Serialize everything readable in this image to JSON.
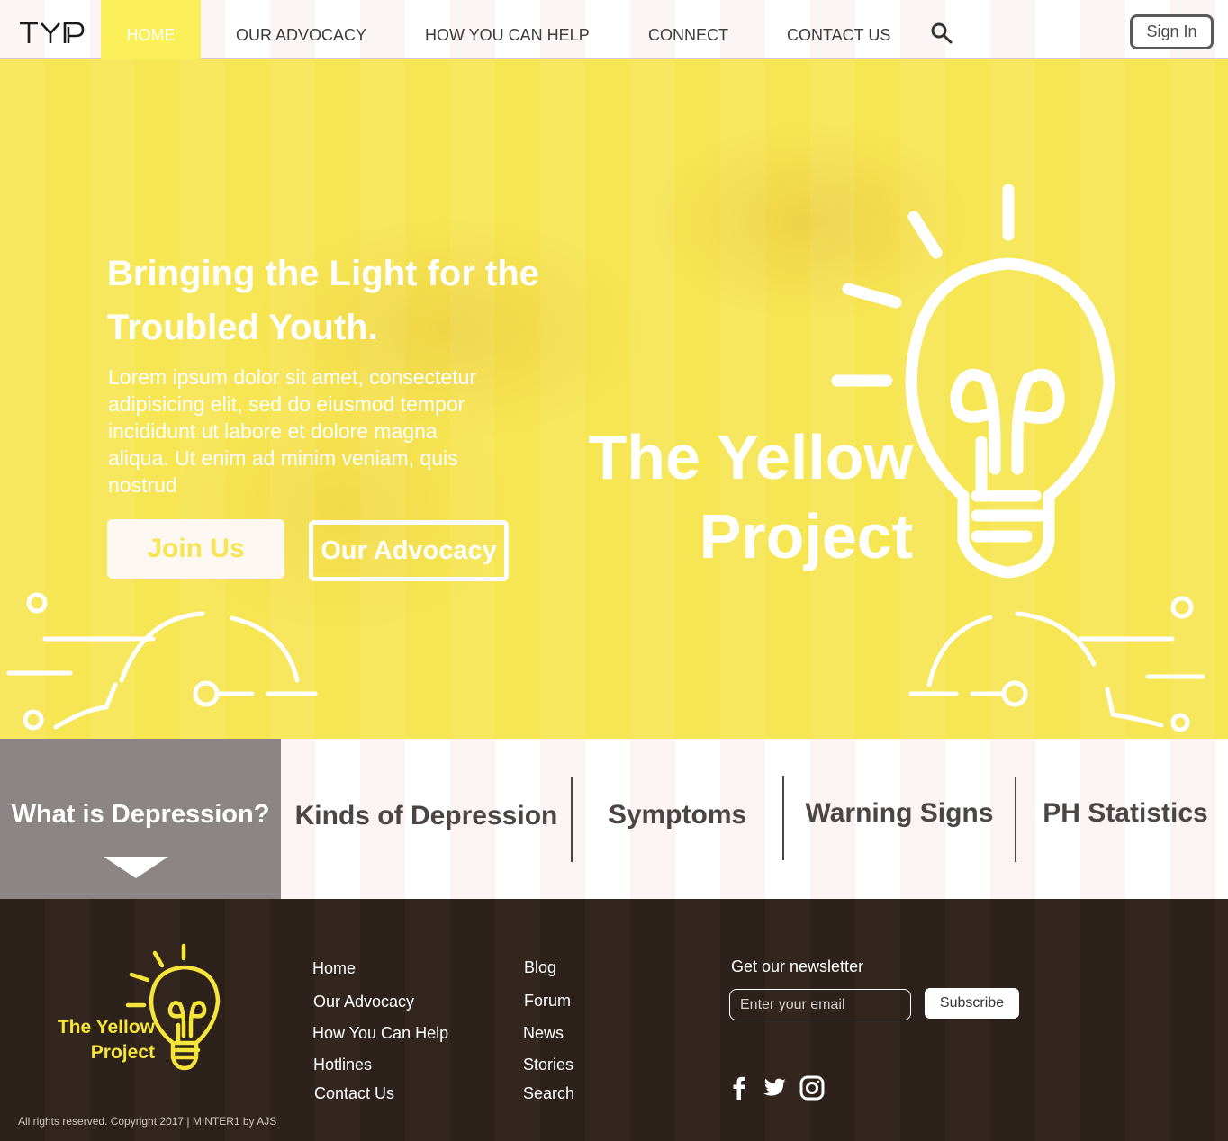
{
  "nav": {
    "logo_text": "TYP",
    "items": [
      "HOME",
      "OUR ADVOCACY",
      "HOW YOU CAN HELP",
      "CONNECT",
      "CONTACT US"
    ],
    "sign_in": "Sign In",
    "search_icon": "search-icon",
    "accent_color": "#fbf05a"
  },
  "hero": {
    "title_line1": "Bringing the Light for the",
    "title_line2": "Troubled Youth.",
    "text": "Lorem ipsum dolor sit amet, consectetur adipisicing elit, sed do eiusmod tempor incididunt ut labore et dolore magna aliqua. Ut enim ad minim veniam, quis nostrud",
    "join_button": "Join Us",
    "advocacy_button": "Our Advocacy",
    "brand_line1": "The Yellow",
    "brand_line2": "Project",
    "bulb_icon": "lightbulb-icon",
    "background_color": "#f7e654"
  },
  "tabs": {
    "active": "What is Depression?",
    "items": [
      "Kinds of Depression",
      "Symptoms",
      "Warning Signs",
      "PH Statistics"
    ],
    "active_bg": "#8c8585"
  },
  "footer": {
    "brand_line1": "The Yellow",
    "brand_line2": "Project",
    "col1": [
      "Home",
      "Our Advocacy",
      "How You Can Help",
      "Hotlines",
      "Contact Us"
    ],
    "col2": [
      "Blog",
      "Forum",
      "News",
      "Stories",
      "Search"
    ],
    "newsletter_label": "Get our newsletter",
    "email_placeholder": "Enter your email",
    "subscribe": "Subscribe",
    "social": [
      "facebook-icon",
      "twitter-icon",
      "instagram-icon"
    ],
    "copyright": "All rights reserved. Copyright 2017 | MINTER1 by AJS",
    "background_color": "#33261f",
    "brand_color": "#f5e53a"
  }
}
